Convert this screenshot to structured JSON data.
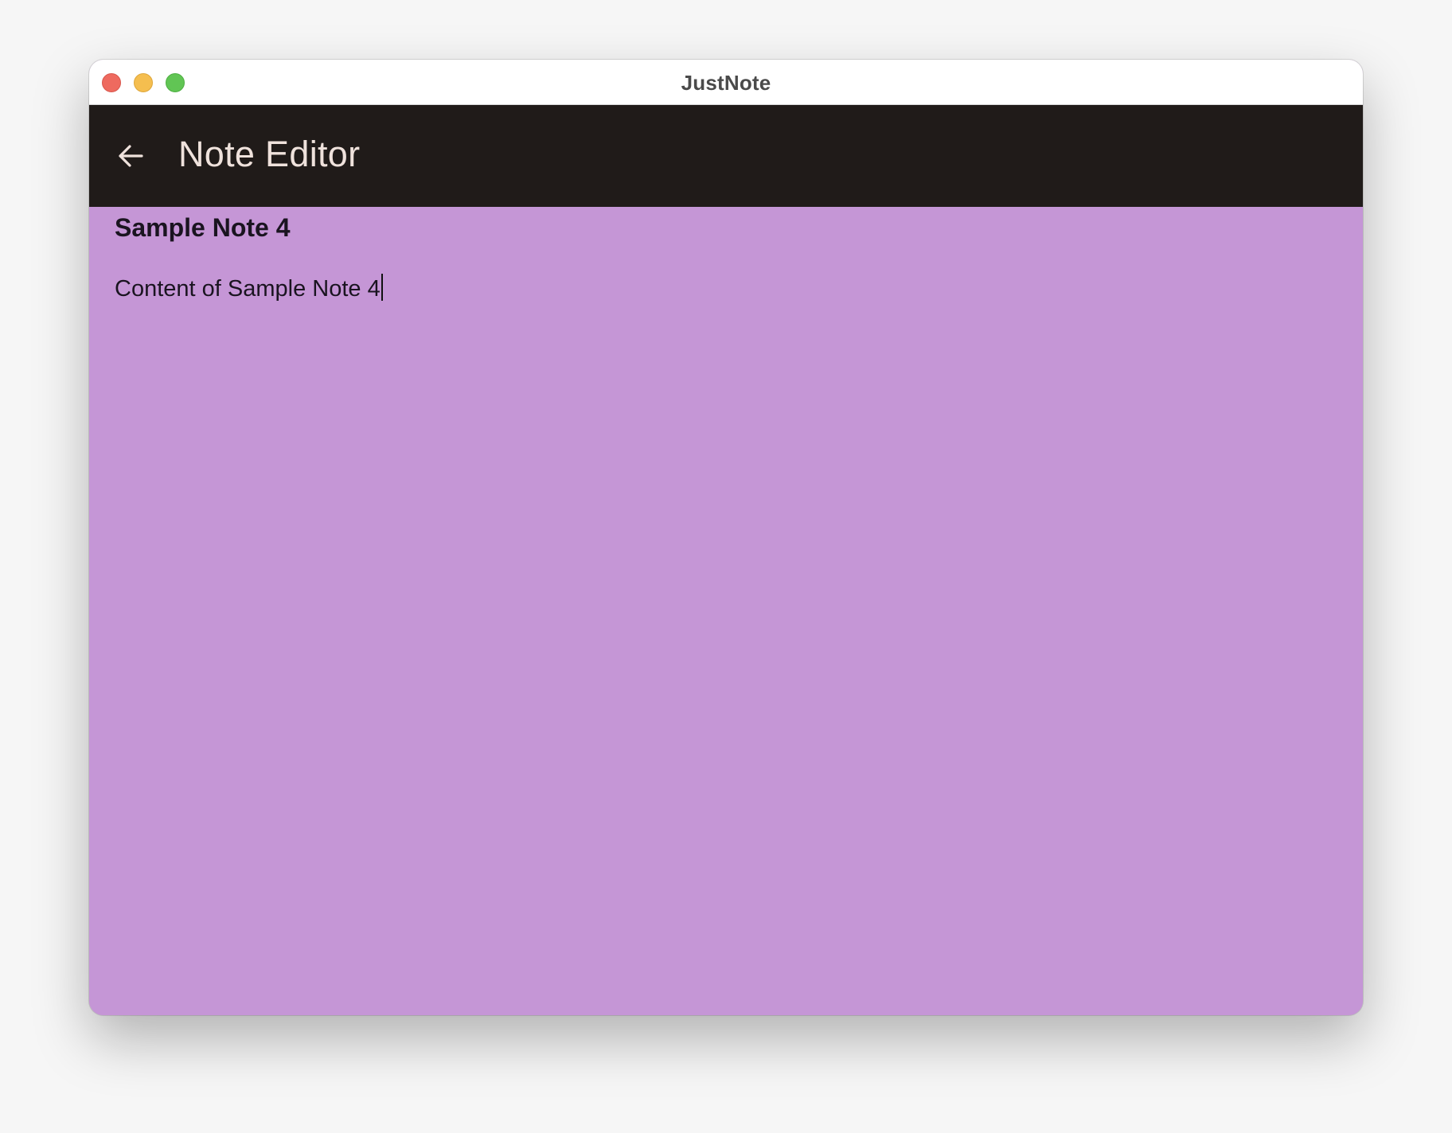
{
  "window": {
    "title": "JustNote",
    "controls": [
      "close",
      "minimize",
      "maximize"
    ]
  },
  "appbar": {
    "back_icon": "arrow-left-icon",
    "title": "Note Editor"
  },
  "note": {
    "title": "Sample Note 4",
    "content": "Content of Sample Note 4"
  },
  "colors": {
    "appbar_bg": "#201b19",
    "appbar_text": "#efe2dc",
    "note_bg": "#c596d6",
    "note_text": "#1a1420"
  }
}
